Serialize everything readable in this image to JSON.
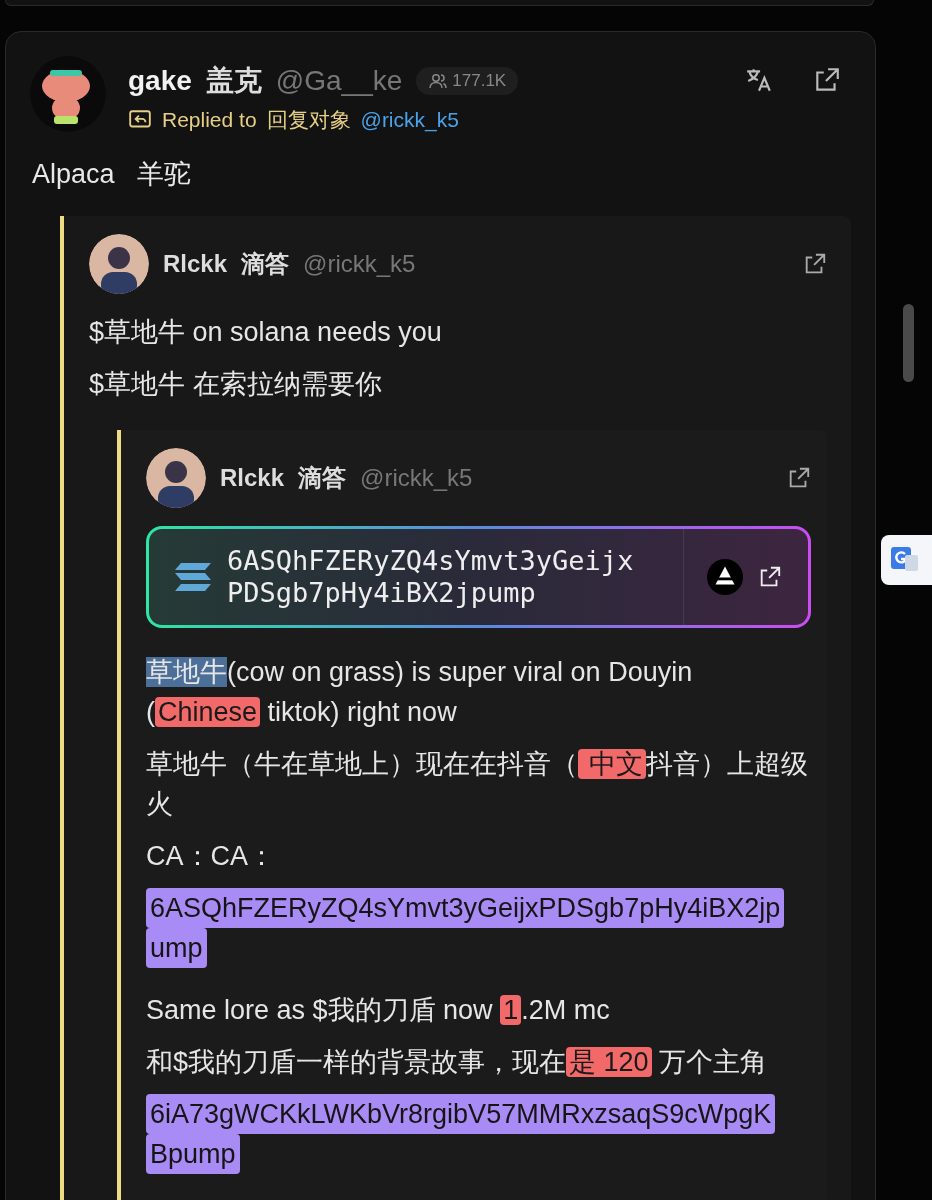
{
  "post": {
    "author": {
      "name": "gake",
      "name_cn": "盖克",
      "handle": "@Ga__ke",
      "followers": "177.1K"
    },
    "reply": {
      "label": "Replied to",
      "label_cn": "回复对象",
      "target": "@rickk_k5"
    },
    "body": "Alpaca   羊驼",
    "quote": {
      "author": {
        "name": "Rlckk",
        "name_cn": "滴答",
        "handle": "@rickk_k5"
      },
      "paragraphs": [
        {
          "segments": [
            {
              "text": "$草地牛 on solana needs you"
            }
          ]
        },
        {
          "segments": [
            {
              "text": "$草地牛 在索拉纳需要你"
            }
          ]
        }
      ],
      "quote": {
        "author": {
          "name": "Rlckk",
          "name_cn": "滴答",
          "handle": "@rickk_k5"
        },
        "token": {
          "address_lines": [
            "6ASQhFZERyZQ4sYmvt3yGeijx",
            "PDSgb7pHy4iBX2jpump"
          ]
        },
        "paragraphs": [
          {
            "segments": [
              {
                "text": "草地牛",
                "kind": "selection"
              },
              {
                "text": "(cow on grass) is super viral on Douyin ("
              },
              {
                "text": "Chinese",
                "kind": "highlight"
              },
              {
                "text": " tiktok) right now"
              }
            ]
          },
          {
            "segments": [
              {
                "text": "草地牛（牛在草地上）现在在抖音（"
              },
              {
                "text": " 中文",
                "kind": "highlight"
              },
              {
                "text": "抖音）上超级火"
              }
            ]
          },
          {
            "segments": [
              {
                "text": "CA：CA："
              }
            ]
          },
          {
            "segments": [
              {
                "lines": [
                  "6ASQhFZERyZQ4sYmvt3yGeijxPDSgb7pHy4iBX2jp",
                  "ump"
                ],
                "kind": "address"
              }
            ]
          },
          {
            "segments": [
              {
                "text": "Same lore as $我的刀盾 now "
              },
              {
                "text": "1",
                "kind": "highlight"
              },
              {
                "text": ".2M mc"
              }
            ]
          },
          {
            "segments": [
              {
                "text": "和$我的刀盾一样的背景故事，现在"
              },
              {
                "text": "是 120",
                "kind": "highlight"
              },
              {
                "text": " 万个主角"
              }
            ]
          },
          {
            "segments": [
              {
                "lines": [
                  "6iA73gWCKkLWKbVr8rgibV57MMRxzsaqS9cWpgK",
                  "Bpump"
                ],
                "kind": "address"
              }
            ]
          }
        ]
      }
    }
  }
}
